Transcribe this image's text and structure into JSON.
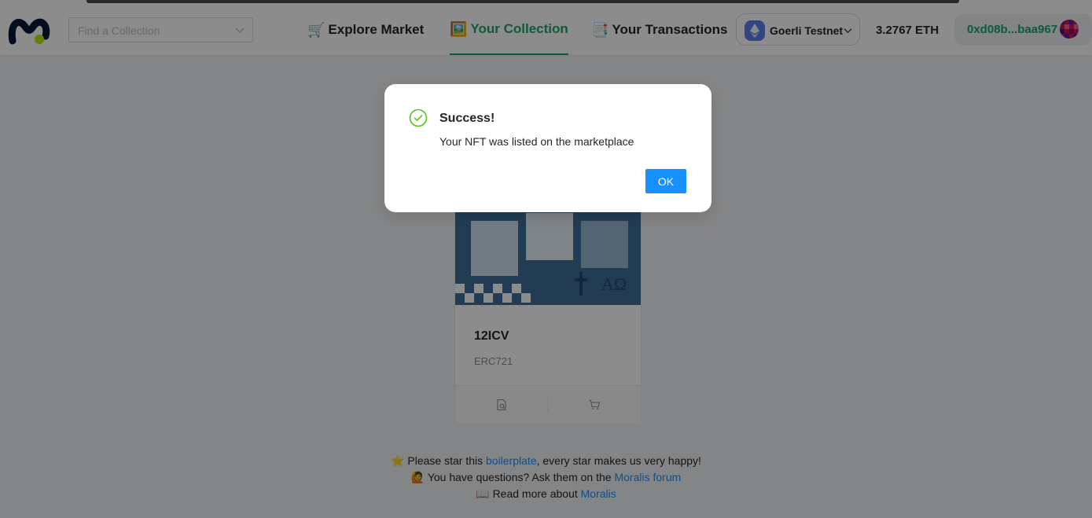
{
  "app": {
    "logo_icon": "moralis-logo-icon"
  },
  "header": {
    "search_placeholder": "Find a Collection",
    "nav": [
      {
        "label": "Explore Market",
        "icon": "🛒"
      },
      {
        "label": "Your Collection",
        "icon": "🖼️"
      },
      {
        "label": "Your Transactions",
        "icon": "📑"
      }
    ],
    "chain_label": "Goerli Testnet",
    "balance": "3.2767 ETH",
    "address": "0xd08b...baa967",
    "accent_color": "#17a86b"
  },
  "nft": {
    "name": "12ICV",
    "standard": "ERC721"
  },
  "footer": {
    "line1_icon": "⭐️",
    "line1_a": "Please star this ",
    "line1_link": "boilerplate",
    "line1_b": ", every star makes us very happy!",
    "line2_icon": "🙋",
    "line2_a": "You have questions? Ask them on the ",
    "line2_link": "Moralis forum",
    "line3_icon": "📖",
    "line3_a": "Read more about ",
    "line3_link": "Moralis"
  },
  "modal": {
    "title": "Success!",
    "content": "Your NFT was listed on the marketplace",
    "ok_label": "OK"
  }
}
